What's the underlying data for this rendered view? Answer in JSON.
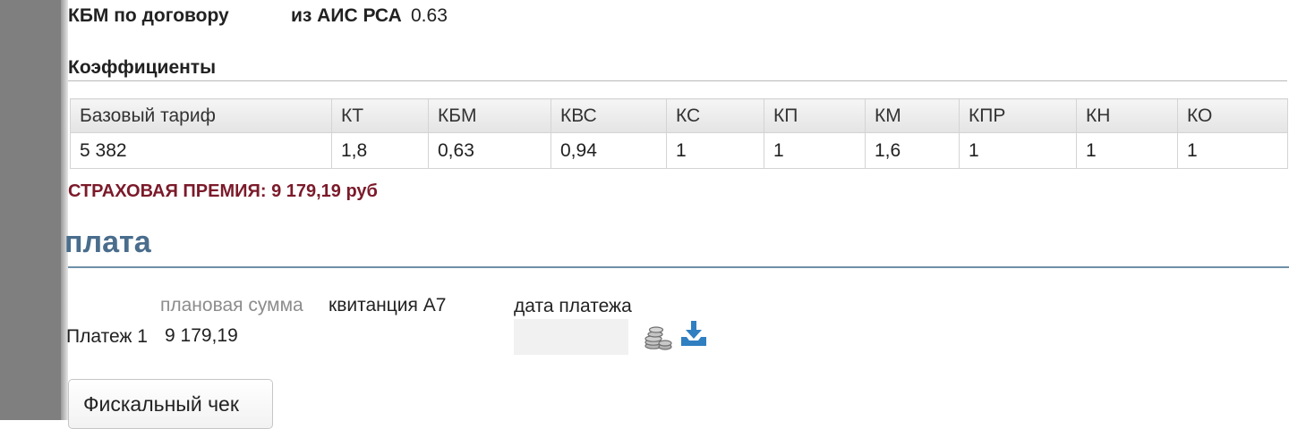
{
  "kbm": {
    "label": "КБМ по договору",
    "source": "из АИС РСА",
    "value": "0.63"
  },
  "coefficients": {
    "title": "Коэффициенты",
    "headers": [
      "Базовый тариф",
      "КТ",
      "КБМ",
      "КВС",
      "КС",
      "КП",
      "КМ",
      "КПР",
      "КН",
      "КО"
    ],
    "values": [
      "5 382",
      "1,8",
      "0,63",
      "0,94",
      "1",
      "1",
      "1,6",
      "1",
      "1",
      "1"
    ]
  },
  "premium": {
    "text": "СТРАХОВАЯ ПРЕМИЯ: 9 179,19 руб"
  },
  "payment": {
    "section_title": "плата",
    "headers": {
      "planned_amount": "плановая сумма",
      "receipt": "квитанция А7",
      "payment_date": "дата платежа"
    },
    "row": {
      "label": "Платеж 1",
      "amount": "9 179,19",
      "date": ""
    },
    "icons": {
      "pay": "coins-icon",
      "download": "download-icon"
    },
    "fiscal_button": "Фискальный чек"
  },
  "colors": {
    "premium_text": "#7b1a2a",
    "section_title": "#4a6d8c",
    "download_icon": "#2f7fc1",
    "left_bar": "#7f7f7f"
  }
}
